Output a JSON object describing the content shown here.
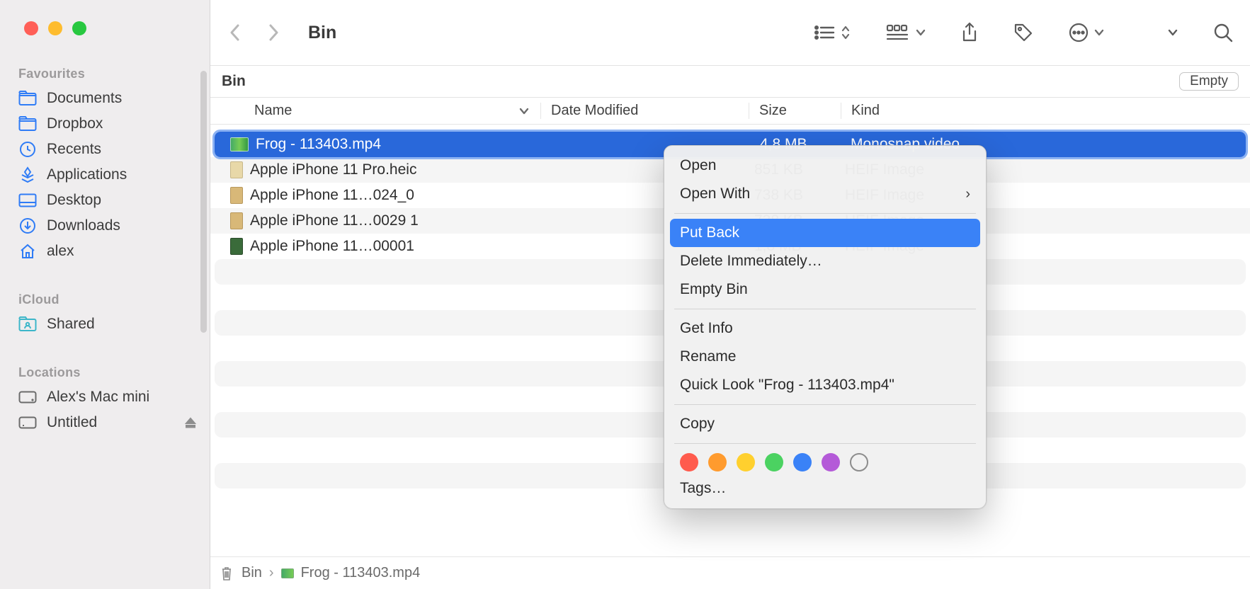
{
  "window": {
    "title": "Bin",
    "location_label": "Bin",
    "empty_button": "Empty"
  },
  "sidebar": {
    "sections": [
      {
        "label": "Favourites",
        "items": [
          {
            "icon": "folder",
            "label": "Documents"
          },
          {
            "icon": "folder",
            "label": "Dropbox"
          },
          {
            "icon": "clock",
            "label": "Recents"
          },
          {
            "icon": "apps",
            "label": "Applications"
          },
          {
            "icon": "desktop",
            "label": "Desktop"
          },
          {
            "icon": "download",
            "label": "Downloads"
          },
          {
            "icon": "home",
            "label": "alex"
          }
        ]
      },
      {
        "label": "iCloud",
        "items": [
          {
            "icon": "shared",
            "label": "Shared"
          }
        ]
      },
      {
        "label": "Locations",
        "items": [
          {
            "icon": "mac",
            "label": "Alex's Mac mini"
          },
          {
            "icon": "disk",
            "label": "Untitled",
            "eject": true
          }
        ]
      }
    ]
  },
  "columns": {
    "name": "Name",
    "date": "Date Modified",
    "size": "Size",
    "kind": "Kind"
  },
  "files": [
    {
      "name": "Frog - 113403.mp4",
      "size": "4,8 MB",
      "kind": "Monosnap video",
      "selected": true
    },
    {
      "name": "Apple iPhone 11 Pro.heic",
      "size": "851 KB",
      "kind": "HEIF Image",
      "selected": false
    },
    {
      "name": "Apple iPhone 11…024_0",
      "size": "738 KB",
      "kind": "HEIF Image",
      "selected": false
    },
    {
      "name": "Apple iPhone 11…0029 1",
      "size": "738 KB",
      "kind": "HEIF Image",
      "selected": false
    },
    {
      "name": "Apple iPhone 11…00001",
      "size": "1,8 MB",
      "kind": "HEIF Image",
      "selected": false
    }
  ],
  "context_menu": {
    "open": "Open",
    "open_with": "Open With",
    "put_back": "Put Back",
    "delete_immediately": "Delete Immediately…",
    "empty_bin": "Empty Bin",
    "get_info": "Get Info",
    "rename": "Rename",
    "quick_look": "Quick Look \"Frog - 113403.mp4\"",
    "copy": "Copy",
    "tags": "Tags…",
    "tag_colors": [
      "#ff5b4d",
      "#ff9b2e",
      "#ffd02e",
      "#4bd261",
      "#3a82f7",
      "#b45ad8"
    ]
  },
  "pathbar": {
    "root": "Bin",
    "file": "Frog - 113403.mp4"
  }
}
